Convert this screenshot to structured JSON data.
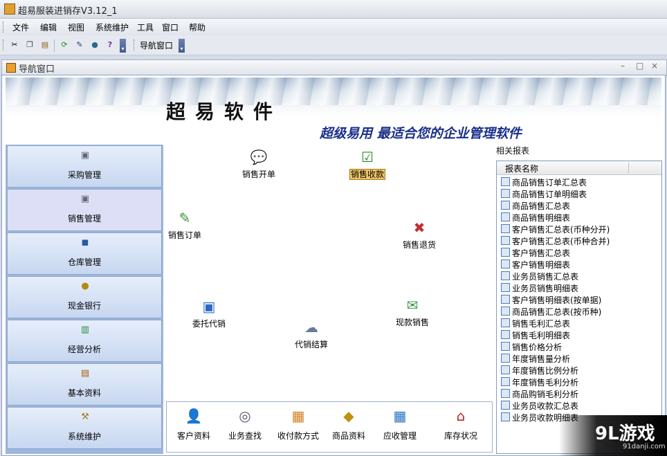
{
  "window": {
    "title": "超易服装进销存V3.12_1"
  },
  "menu": [
    "文件",
    "编辑",
    "视图",
    "系统维护",
    "工具",
    "窗口",
    "帮助"
  ],
  "toolbar": {
    "icons": [
      "cut-icon",
      "copy-icon",
      "paste-icon",
      "refresh-icon",
      "edit-icon",
      "globe-icon",
      "help-icon"
    ],
    "nav_button_label": "导航窗口"
  },
  "child_window": {
    "title": "导航窗口",
    "controls": [
      "–",
      "□",
      "×"
    ]
  },
  "banner": {
    "brand": "超易软件",
    "slogan": "超级易用 最适合您的企业管理软件"
  },
  "left_nav": [
    {
      "label": "采购管理",
      "icon": "cart-icon",
      "selected": false
    },
    {
      "label": "销售管理",
      "icon": "cart-icon",
      "selected": true
    },
    {
      "label": "仓库管理",
      "icon": "warehouse-icon",
      "selected": false
    },
    {
      "label": "现金银行",
      "icon": "money-bag-icon",
      "selected": false
    },
    {
      "label": "经营分析",
      "icon": "chart-icon",
      "selected": false
    },
    {
      "label": "基本资料",
      "icon": "book-icon",
      "selected": false
    },
    {
      "label": "系统维护",
      "icon": "hammer-icon",
      "selected": false
    }
  ],
  "workflow": [
    {
      "label": "销售开单",
      "icon": "chat-add-icon"
    },
    {
      "label": "销售收款",
      "icon": "check-box-icon",
      "highlighted": true
    },
    {
      "label": "销售订单",
      "icon": "chat-edit-icon"
    },
    {
      "label": "销售退货",
      "icon": "chat-cancel-icon"
    },
    {
      "label": "委托代销",
      "icon": "window-icon"
    },
    {
      "label": "代销结算",
      "icon": "chat-multi-icon"
    },
    {
      "label": "现款销售",
      "icon": "envelope-icon"
    }
  ],
  "tools": [
    {
      "label": "客户资料",
      "icon": "person-icon"
    },
    {
      "label": "业务查找",
      "icon": "binoculars-icon"
    },
    {
      "label": "收付款方式",
      "icon": "card-icon"
    },
    {
      "label": "商品资料",
      "icon": "goods-icon"
    },
    {
      "label": "应收管理",
      "icon": "calendar-icon"
    },
    {
      "label": "库存状况",
      "icon": "store-icon"
    }
  ],
  "reports": {
    "title": "相关报表",
    "column": "报表名称",
    "items": [
      "商品销售订单汇总表",
      "商品销售订单明细表",
      "商品销售汇总表",
      "商品销售明细表",
      "客户销售汇总表(币种分开)",
      "客户销售汇总表(币种合并)",
      "客户销售汇总表",
      "客户销售明细表",
      "业务员销售汇总表",
      "业务员销售明细表",
      "客户销售明细表(按单据)",
      "商品销售汇总表(按币种)",
      "销售毛利汇总表",
      "销售毛利明细表",
      "销售价格分析",
      "年度销售量分析",
      "年度销售比例分析",
      "年度销售毛利分析",
      "商品购销毛利分析",
      "业务员收款汇总表",
      "业务员收款明细表"
    ]
  },
  "watermark": {
    "logo": "9L游戏",
    "url": "91danji.com"
  }
}
